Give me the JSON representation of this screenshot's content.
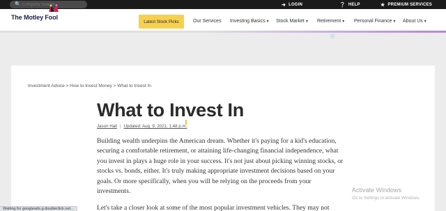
{
  "topbar": {
    "search_placeholder": "Company Search",
    "login_label": "LOGIN",
    "help_label": "HELP",
    "premium_label": "PREMIUM SERVICES"
  },
  "brand": {
    "logo_text": "The Motley Fool",
    "colors": {
      "navy": "#1b1f4b",
      "gold": "#f7d14c",
      "purple": "#b583e0",
      "hat_red": "#d6264a"
    }
  },
  "nav": {
    "cta_label": "Latest Stock Picks",
    "items": [
      {
        "label": "Our Services",
        "has_caret": false
      },
      {
        "label": "Investing Basics",
        "has_caret": true
      },
      {
        "label": "Stock Market",
        "has_caret": true
      },
      {
        "label": "Retirement",
        "has_caret": true
      },
      {
        "label": "Personal Finance",
        "has_caret": true
      },
      {
        "label": "About Us",
        "has_caret": true
      }
    ]
  },
  "article": {
    "breadcrumb": "Investment Advice > How to Invest Money > What to Invest In",
    "title": "What to Invest In",
    "author": "Jason Hall",
    "updated": "Updated: Aug. 9, 2021, 1:48 p.m.",
    "paragraph1": "Building wealth underpins the American dream. Whether it's paying for a kid's education, securing a comfortable retirement, or attaining life-changing financial independence, what you invest in plays a huge role in your success. It's not just about picking winning stocks, or stocks vs. bonds, either. It's truly making appropriate investment decisions based on your goals. Or more specifically, when you will be relying on the proceeds from your investments.",
    "paragraph2": "Let's take a closer look at some of the most popular investment vehicles. They may not"
  },
  "overlay": {
    "activate_title": "Activate Windows",
    "activate_sub": "Go to Settings to activate Windows."
  },
  "status": "Waiting for googleads.g.doubleclick.net..."
}
